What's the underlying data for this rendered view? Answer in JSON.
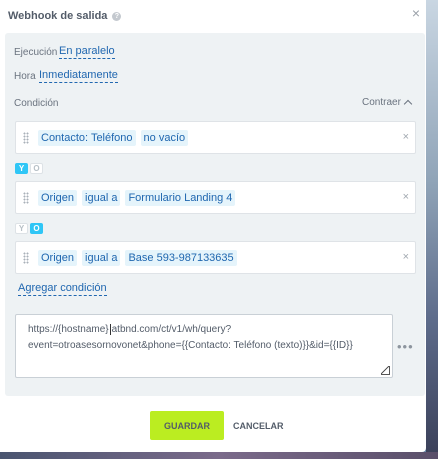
{
  "dialog": {
    "title": "Webhook de salida",
    "help_icon": "?",
    "close_icon": "×"
  },
  "settings": {
    "execution_label": "Ejecución",
    "execution_value": "En paralelo",
    "time_label": "Hora",
    "time_value": "Inmediatamente"
  },
  "conditions": {
    "label": "Condición",
    "collapse_label": "Contraer",
    "items": [
      {
        "parts": [
          "Contacto: Teléfono",
          "no vacío"
        ]
      },
      {
        "parts": [
          "Origen",
          "igual a",
          "Formulario Landing 4"
        ]
      },
      {
        "parts": [
          "Origen",
          "igual a",
          "Base 593-987133635"
        ]
      }
    ],
    "joiners": [
      {
        "and": "Y",
        "or": "O",
        "selected": "Y"
      },
      {
        "and": "Y",
        "or": "O",
        "selected": "O"
      }
    ],
    "remove_icon": "×",
    "add_label": "Agregar condición"
  },
  "url": {
    "line1_before_caret": "https://{hostname}",
    "line1_after_caret": "atbnd.com/ct/v1/wh/query?",
    "line2": "event=otroasesornovonet&phone={{Contacto: Teléfono (texto)}}&id={{ID}}",
    "more_icon": "•••"
  },
  "footer": {
    "save_label": "GUARDAR",
    "cancel_label": "CANCELAR"
  },
  "colors": {
    "accent": "#2fc6f6",
    "save_button": "#bbed21",
    "link": "#2067b0",
    "panel": "#eef2f4"
  }
}
